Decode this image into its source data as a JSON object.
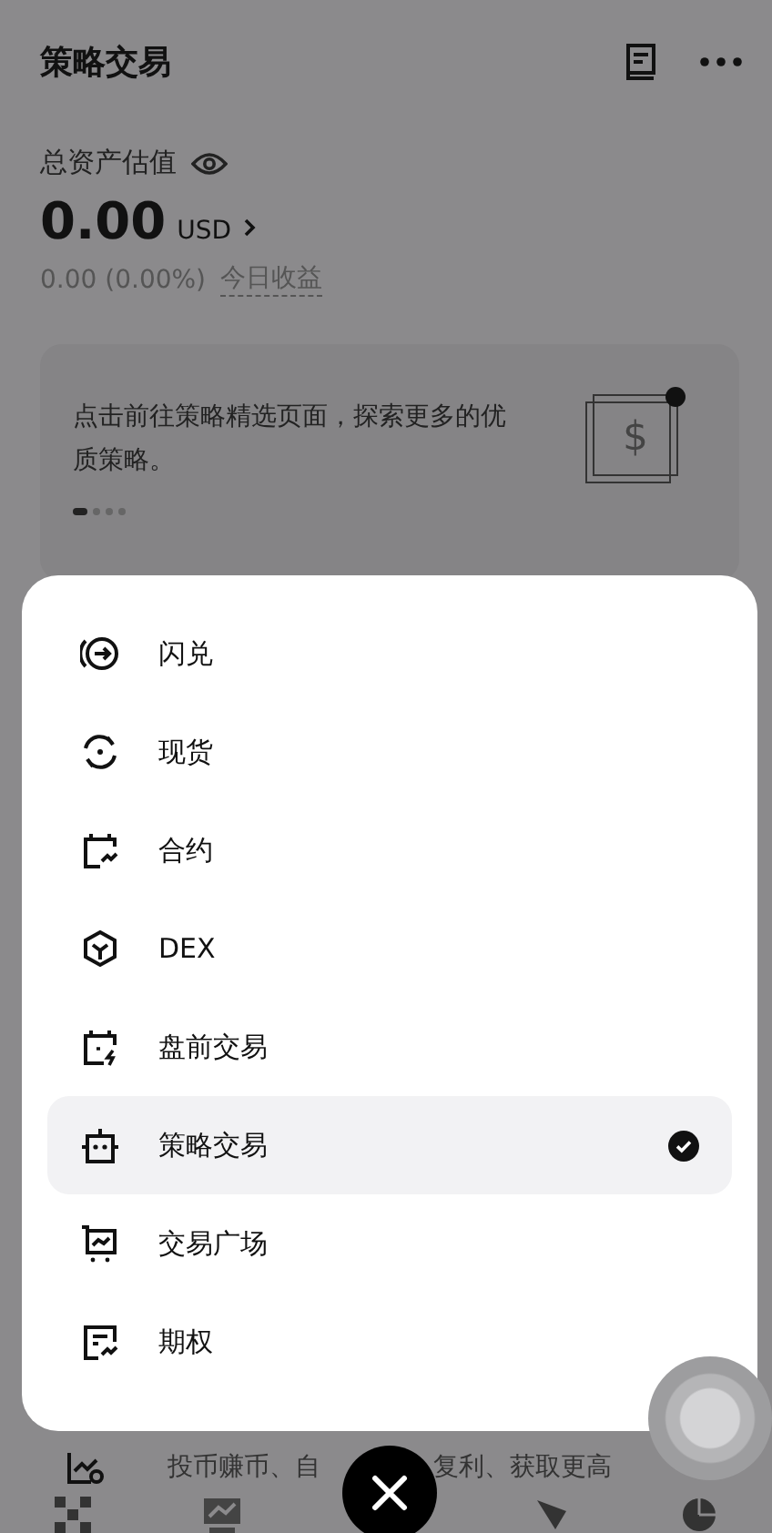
{
  "header": {
    "title": "策略交易"
  },
  "assets": {
    "label": "总资产估值",
    "amount": "0.00",
    "currency": "USD",
    "change": "0.00 (0.00%)",
    "change_label": "今日收益"
  },
  "banner": {
    "text": "点击前往策略精选页面，探索更多的优质策略。",
    "symbol": "$",
    "pages": [
      {
        "selected": true
      },
      {
        "selected": false
      },
      {
        "selected": false
      },
      {
        "selected": false
      }
    ]
  },
  "product": {
    "description_parts": [
      "投币赚币、自",
      "复利、获取更高"
    ]
  },
  "menu": {
    "items": [
      {
        "kind": "swap",
        "label": "闪兑",
        "selected": false
      },
      {
        "kind": "spot",
        "label": "现货",
        "selected": false
      },
      {
        "kind": "futures",
        "label": "合约",
        "selected": false
      },
      {
        "kind": "dex",
        "label": "DEX",
        "selected": false
      },
      {
        "kind": "premarket",
        "label": "盘前交易",
        "selected": false
      },
      {
        "kind": "bot",
        "label": "策略交易",
        "selected": true
      },
      {
        "kind": "square",
        "label": "交易广场",
        "selected": false
      },
      {
        "kind": "options",
        "label": "期权",
        "selected": false
      }
    ]
  }
}
